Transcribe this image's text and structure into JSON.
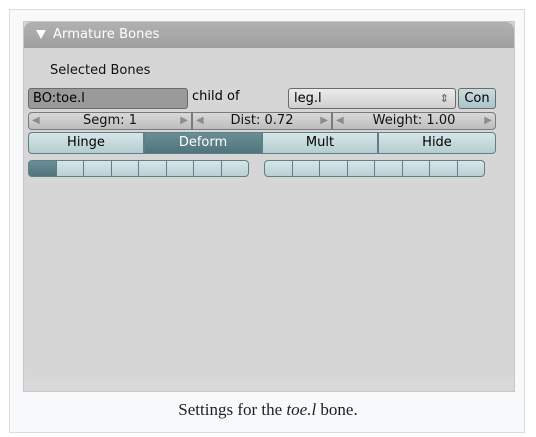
{
  "panel": {
    "title": "Armature Bones",
    "section_label": "Selected Bones"
  },
  "bone": {
    "name": "BO:toe.l",
    "child_of_label": "child of",
    "parent": "leg.l",
    "con_label": "Con"
  },
  "numbers": {
    "segm": "Segm: 1",
    "dist": "Dist: 0.72",
    "weight": "Weight: 1.00"
  },
  "toggles": {
    "hinge": "Hinge",
    "deform": "Deform",
    "mult": "Mult",
    "hide": "Hide",
    "deform_active": true
  },
  "layers": {
    "active": [
      1
    ],
    "count": 16
  },
  "caption": {
    "prefix": "Settings for the ",
    "bone": "toe.l",
    "suffix": " bone."
  }
}
